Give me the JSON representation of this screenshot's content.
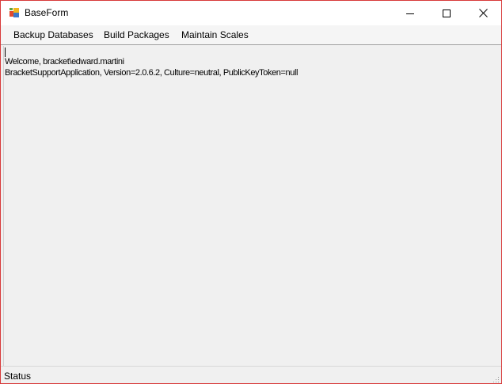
{
  "window": {
    "title": "BaseForm",
    "controls": {
      "minimize_icon": "minimize-icon",
      "maximize_icon": "maximize-icon",
      "close_icon": "close-icon"
    }
  },
  "menu": {
    "items": [
      {
        "label": "Backup Databases"
      },
      {
        "label": "Build Packages"
      },
      {
        "label": "Maintain Scales"
      }
    ]
  },
  "output": {
    "lines": [
      "Welcome, bracket\\edward.martini",
      "BracketSupportApplication, Version=2.0.6.2, Culture=neutral, PublicKeyToken=null"
    ]
  },
  "status": {
    "text": "Status"
  },
  "colors": {
    "window_border": "#d83a3a",
    "background": "#f0f0f0",
    "titlebar": "#ffffff"
  }
}
